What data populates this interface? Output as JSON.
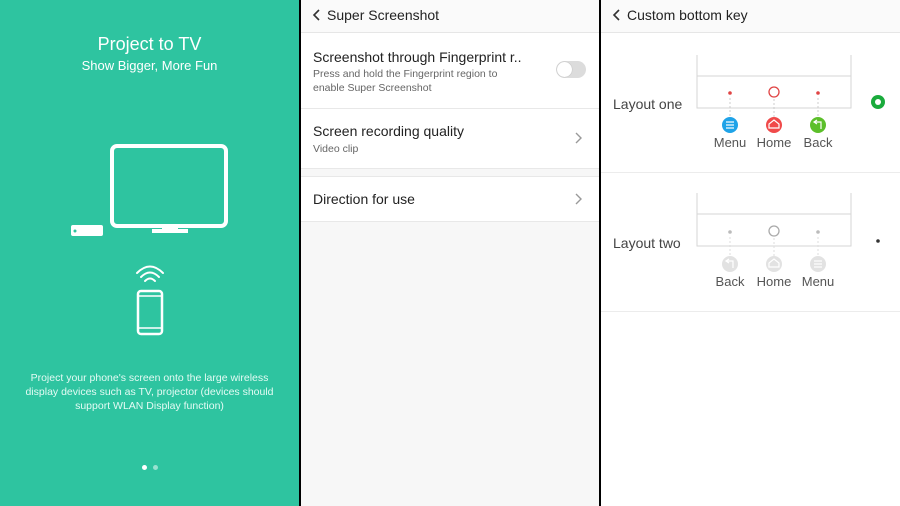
{
  "panel_intro": {
    "title": "Project to TV",
    "subtitle": "Show Bigger, More Fun",
    "description": "Project your phone's screen onto the large wireless display devices such as TV, projector (devices should support WLAN Display function)",
    "page_indicator": {
      "current": 1,
      "total": 2
    },
    "background_color": "#2ec4a0",
    "icons": [
      "tv-icon",
      "set-top-box-icon",
      "wifi-signal-icon",
      "phone-icon"
    ]
  },
  "panel_screenshot": {
    "header": {
      "title": "Super Screenshot"
    },
    "rows": [
      {
        "title": "Screenshot through Fingerprint r..",
        "subtitle_line1": "Press and hold the Fingerprint region to",
        "subtitle_line2": "enable Super Screenshot",
        "toggle": false
      },
      {
        "title": "Screen recording quality",
        "subtitle": "Video clip"
      },
      {
        "title": "Direction for use"
      }
    ]
  },
  "panel_bottom_key": {
    "header": {
      "title": "Custom bottom key"
    },
    "layouts": [
      {
        "label": "Layout one",
        "keys": [
          "Menu",
          "Home",
          "Back"
        ],
        "selected": true,
        "key_colors": [
          "#1fa3e8",
          "#f04a4a",
          "#5cbf2a"
        ]
      },
      {
        "label": "Layout two",
        "keys": [
          "Back",
          "Home",
          "Menu"
        ],
        "selected": false
      }
    ],
    "accent_color": "#1aab3c"
  }
}
